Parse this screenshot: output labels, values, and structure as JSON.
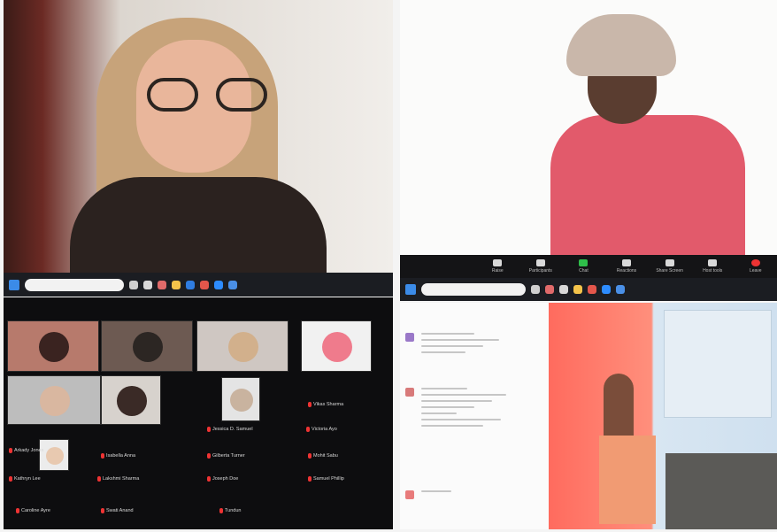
{
  "top_right": {
    "controls": [
      {
        "label": "Raise",
        "icon": "raise-icon",
        "variant": "plain"
      },
      {
        "label": "Participants",
        "icon": "participants-icon",
        "variant": "plain"
      },
      {
        "label": "Chat",
        "icon": "chat-icon",
        "variant": "green"
      },
      {
        "label": "Reactions",
        "icon": "reactions-icon",
        "variant": "plain"
      },
      {
        "label": "Share Screen",
        "icon": "share-icon",
        "variant": "plain"
      },
      {
        "label": "Host tools",
        "icon": "host-icon",
        "variant": "plain"
      },
      {
        "label": "Leave",
        "icon": "leave-icon",
        "variant": "red"
      }
    ]
  },
  "gallery": {
    "tiles": [
      {
        "name": "",
        "bg": "#b77a6c",
        "avatar": "#3a2320"
      },
      {
        "name": "",
        "bg": "#6d5a52",
        "avatar": "#2c2623"
      },
      {
        "name": "",
        "bg": "#cfc7c2",
        "avatar": "#d2b08c"
      },
      {
        "name": "",
        "bg": "#f1f1f1",
        "avatar": "#ef7b8c"
      },
      {
        "name": "",
        "bg": "#bdbdbd",
        "avatar": "#d9b7a0"
      },
      {
        "name": "",
        "bg": "#d7d2cd",
        "avatar": "#3a2a26"
      },
      {
        "name": "",
        "bg": "#e4e4e4",
        "avatar": "#c9b39f"
      },
      {
        "name": "",
        "bg": "#ececec",
        "avatar": "#e8c9b0"
      }
    ],
    "names": [
      "Vikas Sharma",
      "Victoria Ayo",
      "Jessica D. Samuel",
      "Arkady Jones",
      "Isabella Anna",
      "Gilberta Turner",
      "Mohit Sabu",
      "Kathryn Lee",
      "Lakshmi Sharma",
      "Joseph Doe",
      "Samuel Phillip",
      "Caroline Ayre",
      "Swati Anand",
      "Tundun"
    ]
  },
  "taskbar": {
    "clock_time": "",
    "clock_date": ""
  },
  "colors": {
    "taskbar": "#1b1d22",
    "zoom_green": "#2fbf4a",
    "zoom_red": "#e33333",
    "chat_accent": "#9a78c8"
  }
}
